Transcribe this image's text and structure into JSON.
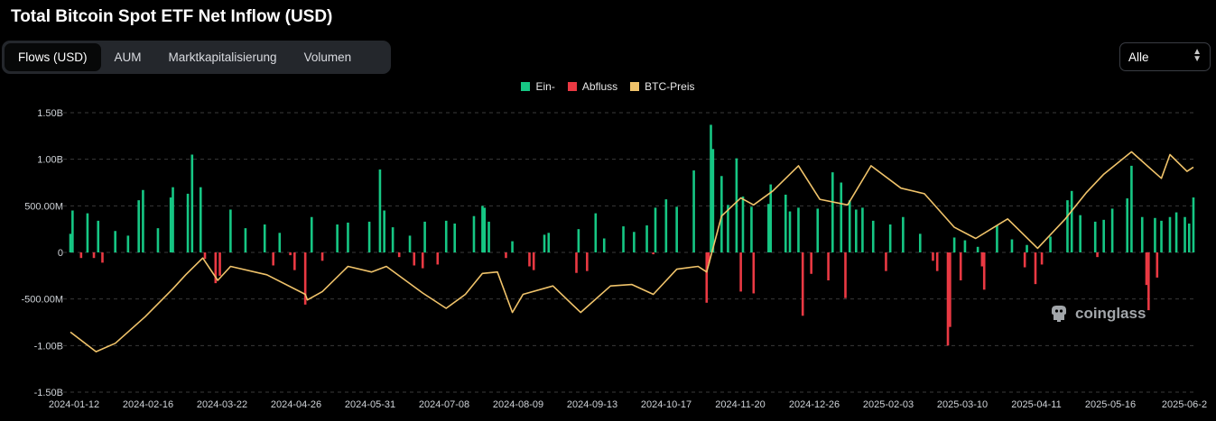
{
  "header": {
    "title": "Total Bitcoin Spot ETF Net Inflow (USD)"
  },
  "tabs": [
    {
      "label": "Flows (USD)",
      "active": true
    },
    {
      "label": "AUM",
      "active": false
    },
    {
      "label": "Marktkapitalisierung",
      "active": false
    },
    {
      "label": "Volumen",
      "active": false
    }
  ],
  "range_select": {
    "value": "Alle"
  },
  "watermark": {
    "text": "coinglass"
  },
  "colors": {
    "inflow": "#16c784",
    "outflow": "#ea3943",
    "price": "#f0c36a",
    "grid": "#3a3a3a",
    "axis_text": "#cfd3d8"
  },
  "chart_data": {
    "type": "bar",
    "title": "Total Bitcoin Spot ETF Net Inflow (USD)",
    "legend": [
      {
        "name": "Ein-",
        "color": "#16c784"
      },
      {
        "name": "Abfluss",
        "color": "#ea3943"
      },
      {
        "name": "BTC-Preis",
        "color": "#f0c36a"
      }
    ],
    "legend_position": "top-center",
    "grid": true,
    "y_ticks": [
      1500000000,
      1000000000,
      500000000,
      0,
      -500000000,
      -1000000000,
      -1500000000
    ],
    "y_tick_labels": [
      "1.50B",
      "1.00B",
      "500.00M",
      "0",
      "-500.00M",
      "-1.00B",
      "-1.50B"
    ],
    "ylim": [
      -1500000000,
      1500000000
    ],
    "x_start": "2024-01-11",
    "x_end": "2025-06-20",
    "x_tick_labels": [
      "2024-01-12",
      "2024-02-16",
      "2024-03-22",
      "2024-04-26",
      "2024-05-31",
      "2024-07-08",
      "2024-08-09",
      "2024-09-13",
      "2024-10-17",
      "2024-11-20",
      "2024-12-26",
      "2025-02-03",
      "2025-03-10",
      "2025-04-11",
      "2025-05-16",
      "2025-06-2"
    ],
    "series": [
      {
        "name": "Ein-",
        "points": [
          [
            "2024-01-11",
            200
          ],
          [
            "2024-01-12",
            450
          ],
          [
            "2024-01-19",
            420
          ],
          [
            "2024-01-24",
            340
          ],
          [
            "2024-02-01",
            230
          ],
          [
            "2024-02-07",
            180
          ],
          [
            "2024-02-12",
            560
          ],
          [
            "2024-02-14",
            670
          ],
          [
            "2024-02-21",
            260
          ],
          [
            "2024-02-27",
            590
          ],
          [
            "2024-02-28",
            700
          ],
          [
            "2024-03-06",
            630
          ],
          [
            "2024-03-08",
            1050
          ],
          [
            "2024-03-12",
            700
          ],
          [
            "2024-03-26",
            460
          ],
          [
            "2024-04-02",
            260
          ],
          [
            "2024-04-11",
            300
          ],
          [
            "2024-04-18",
            210
          ],
          [
            "2024-05-03",
            380
          ],
          [
            "2024-05-15",
            300
          ],
          [
            "2024-05-20",
            320
          ],
          [
            "2024-05-30",
            330
          ],
          [
            "2024-06-04",
            890
          ],
          [
            "2024-06-06",
            450
          ],
          [
            "2024-06-10",
            270
          ],
          [
            "2024-06-18",
            180
          ],
          [
            "2024-06-25",
            330
          ],
          [
            "2024-07-05",
            340
          ],
          [
            "2024-07-09",
            310
          ],
          [
            "2024-07-18",
            390
          ],
          [
            "2024-07-22",
            500
          ],
          [
            "2024-07-23",
            480
          ],
          [
            "2024-07-25",
            330
          ],
          [
            "2024-08-05",
            120
          ],
          [
            "2024-08-20",
            190
          ],
          [
            "2024-08-22",
            210
          ],
          [
            "2024-09-05",
            250
          ],
          [
            "2024-09-13",
            420
          ],
          [
            "2024-09-17",
            150
          ],
          [
            "2024-09-26",
            280
          ],
          [
            "2024-10-01",
            220
          ],
          [
            "2024-10-07",
            290
          ],
          [
            "2024-10-11",
            480
          ],
          [
            "2024-10-16",
            570
          ],
          [
            "2024-10-21",
            490
          ],
          [
            "2024-10-29",
            880
          ],
          [
            "2024-11-06",
            1370
          ],
          [
            "2024-11-07",
            1110
          ],
          [
            "2024-11-11",
            820
          ],
          [
            "2024-11-14",
            510
          ],
          [
            "2024-11-18",
            1010
          ],
          [
            "2024-11-21",
            600
          ],
          [
            "2024-11-25",
            490
          ],
          [
            "2024-12-03",
            520
          ],
          [
            "2024-12-04",
            730
          ],
          [
            "2024-12-11",
            620
          ],
          [
            "2024-12-13",
            440
          ],
          [
            "2024-12-17",
            480
          ],
          [
            "2024-12-26",
            470
          ],
          [
            "2025-01-02",
            860
          ],
          [
            "2025-01-06",
            750
          ],
          [
            "2025-01-10",
            560
          ],
          [
            "2025-01-13",
            460
          ],
          [
            "2025-01-16",
            480
          ],
          [
            "2025-01-21",
            340
          ],
          [
            "2025-01-29",
            300
          ],
          [
            "2025-02-04",
            380
          ],
          [
            "2025-02-12",
            200
          ],
          [
            "2025-02-28",
            160
          ],
          [
            "2025-03-05",
            130
          ],
          [
            "2025-03-11",
            60
          ],
          [
            "2025-03-20",
            290
          ],
          [
            "2025-03-27",
            140
          ],
          [
            "2025-04-03",
            80
          ],
          [
            "2025-04-14",
            170
          ],
          [
            "2025-04-22",
            560
          ],
          [
            "2025-04-24",
            660
          ],
          [
            "2025-04-28",
            400
          ],
          [
            "2025-05-05",
            330
          ],
          [
            "2025-05-09",
            350
          ],
          [
            "2025-05-13",
            470
          ],
          [
            "2025-05-20",
            580
          ],
          [
            "2025-05-22",
            930
          ],
          [
            "2025-05-27",
            380
          ],
          [
            "2025-06-02",
            370
          ],
          [
            "2025-06-05",
            340
          ],
          [
            "2025-06-09",
            380
          ],
          [
            "2025-06-12",
            430
          ],
          [
            "2025-06-16",
            380
          ],
          [
            "2025-06-18",
            310
          ],
          [
            "2025-06-20",
            590
          ]
        ]
      },
      {
        "name": "Abfluss",
        "points": [
          [
            "2024-01-16",
            -60
          ],
          [
            "2024-01-22",
            -60
          ],
          [
            "2024-01-26",
            -110
          ],
          [
            "2024-03-14",
            -70
          ],
          [
            "2024-03-19",
            -330
          ],
          [
            "2024-03-21",
            -250
          ],
          [
            "2024-04-15",
            -140
          ],
          [
            "2024-04-23",
            -30
          ],
          [
            "2024-04-25",
            -190
          ],
          [
            "2024-04-30",
            -560
          ],
          [
            "2024-05-08",
            -90
          ],
          [
            "2024-06-13",
            -50
          ],
          [
            "2024-06-20",
            -140
          ],
          [
            "2024-06-24",
            -170
          ],
          [
            "2024-07-01",
            -130
          ],
          [
            "2024-08-02",
            -60
          ],
          [
            "2024-08-13",
            -150
          ],
          [
            "2024-08-15",
            -190
          ],
          [
            "2024-09-04",
            -220
          ],
          [
            "2024-09-09",
            -200
          ],
          [
            "2024-10-10",
            -20
          ],
          [
            "2024-11-04",
            -540
          ],
          [
            "2024-11-05",
            -120
          ],
          [
            "2024-11-20",
            -420
          ],
          [
            "2024-11-26",
            -440
          ],
          [
            "2024-12-19",
            -680
          ],
          [
            "2024-12-23",
            -230
          ],
          [
            "2024-12-31",
            -300
          ],
          [
            "2025-01-08",
            -490
          ],
          [
            "2025-01-27",
            -200
          ],
          [
            "2025-02-18",
            -90
          ],
          [
            "2025-02-20",
            -200
          ],
          [
            "2025-02-25",
            -1000
          ],
          [
            "2025-02-26",
            -800
          ],
          [
            "2025-03-03",
            -300
          ],
          [
            "2025-03-13",
            -150
          ],
          [
            "2025-03-14",
            -400
          ],
          [
            "2025-04-02",
            -160
          ],
          [
            "2025-04-07",
            -340
          ],
          [
            "2025-04-10",
            -130
          ],
          [
            "2025-05-06",
            -50
          ],
          [
            "2025-05-29",
            -350
          ],
          [
            "2025-05-30",
            -620
          ],
          [
            "2025-06-03",
            -270
          ]
        ]
      },
      {
        "name": "BTC-Preis",
        "points": [
          [
            "2024-01-11",
            46500
          ],
          [
            "2024-01-23",
            39500
          ],
          [
            "2024-02-01",
            42500
          ],
          [
            "2024-02-15",
            52000
          ],
          [
            "2024-02-28",
            62000
          ],
          [
            "2024-03-05",
            67000
          ],
          [
            "2024-03-13",
            73000
          ],
          [
            "2024-03-20",
            65000
          ],
          [
            "2024-03-26",
            70000
          ],
          [
            "2024-04-12",
            67000
          ],
          [
            "2024-04-30",
            60000
          ],
          [
            "2024-05-01",
            58000
          ],
          [
            "2024-05-08",
            61000
          ],
          [
            "2024-05-20",
            70000
          ],
          [
            "2024-05-31",
            68000
          ],
          [
            "2024-06-07",
            70000
          ],
          [
            "2024-06-24",
            60500
          ],
          [
            "2024-07-05",
            55000
          ],
          [
            "2024-07-14",
            60000
          ],
          [
            "2024-07-22",
            67500
          ],
          [
            "2024-07-29",
            68000
          ],
          [
            "2024-08-05",
            53500
          ],
          [
            "2024-08-10",
            60000
          ],
          [
            "2024-08-24",
            63000
          ],
          [
            "2024-09-06",
            53500
          ],
          [
            "2024-09-20",
            63000
          ],
          [
            "2024-09-30",
            63500
          ],
          [
            "2024-10-10",
            60000
          ],
          [
            "2024-10-21",
            69000
          ],
          [
            "2024-10-31",
            70000
          ],
          [
            "2024-11-04",
            68000
          ],
          [
            "2024-11-11",
            88000
          ],
          [
            "2024-11-20",
            94500
          ],
          [
            "2024-11-26",
            92000
          ],
          [
            "2024-12-05",
            97000
          ],
          [
            "2024-12-17",
            106000
          ],
          [
            "2024-12-27",
            94000
          ],
          [
            "2025-01-09",
            92000
          ],
          [
            "2025-01-20",
            106000
          ],
          [
            "2025-02-03",
            98000
          ],
          [
            "2025-02-14",
            96000
          ],
          [
            "2025-02-28",
            84000
          ],
          [
            "2025-03-10",
            80000
          ],
          [
            "2025-03-25",
            87000
          ],
          [
            "2025-04-08",
            76500
          ],
          [
            "2025-04-21",
            87000
          ],
          [
            "2025-05-01",
            96500
          ],
          [
            "2025-05-09",
            103000
          ],
          [
            "2025-05-22",
            111000
          ],
          [
            "2025-06-05",
            101500
          ],
          [
            "2025-06-09",
            110000
          ],
          [
            "2025-06-17",
            104000
          ],
          [
            "2025-06-20",
            105500
          ]
        ]
      }
    ],
    "price_ylim": [
      25000,
      125000
    ],
    "notes": "Bar values in millions of USD; price series uses a hidden secondary axis in USD."
  }
}
